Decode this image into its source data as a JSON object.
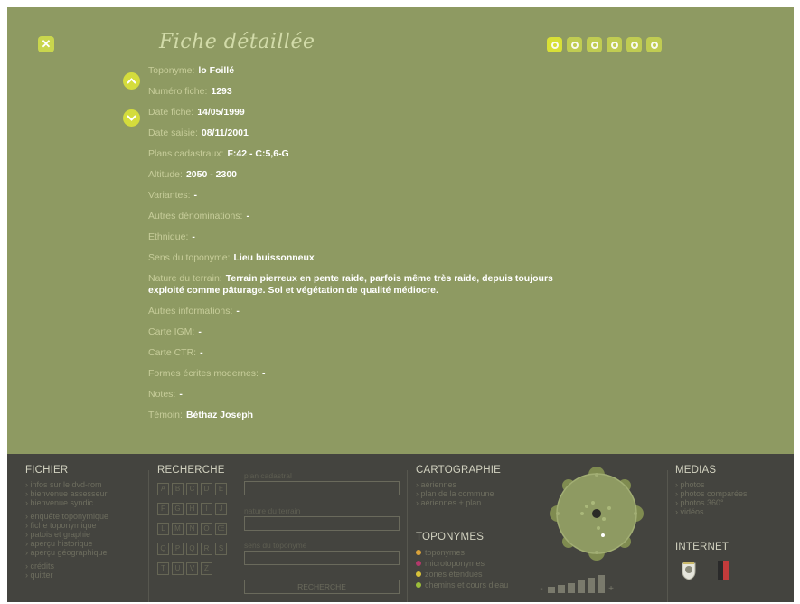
{
  "detail": {
    "title": "Fiche détaillée",
    "close_icon": "close-x-icon",
    "toolbar_icons": [
      "sheet-icon",
      "comment-icon",
      "map-icon",
      "photo-icon",
      "media-icon",
      "print-icon"
    ],
    "nav": {
      "prev_icon": "chevron-up-icon",
      "next_icon": "chevron-down-icon"
    },
    "fields": [
      {
        "label": "Toponyme:",
        "value": "lo Foillé"
      },
      {
        "label": "Numéro fiche:",
        "value": "1293"
      },
      {
        "label": "Date fiche:",
        "value": "14/05/1999"
      },
      {
        "label": "Date saisie:",
        "value": "08/11/2001"
      },
      {
        "label": "Plans cadastraux:",
        "value": "F:42 - C:5,6-G"
      },
      {
        "label": "Altitude:",
        "value": "2050 - 2300"
      },
      {
        "label": "Variantes:",
        "value": "-"
      },
      {
        "label": "Autres dénominations:",
        "value": "-"
      },
      {
        "label": "Ethnique:",
        "value": "-"
      },
      {
        "label": "Sens du toponyme:",
        "value": "Lieu buissonneux"
      },
      {
        "label": "Nature du terrain:",
        "value": "Terrain pierreux en pente raide, parfois même très raide, depuis toujours exploité comme pâturage. Sol et végétation de qualité médiocre."
      },
      {
        "label": "Autres informations:",
        "value": "-"
      },
      {
        "label": "Carte IGM:",
        "value": "-"
      },
      {
        "label": "Carte CTR:",
        "value": "-"
      },
      {
        "label": "Formes écrites modernes:",
        "value": "-"
      },
      {
        "label": "Notes:",
        "value": "-"
      },
      {
        "label": "Témoin:",
        "value": "Béthaz Joseph"
      }
    ]
  },
  "fichier": {
    "title": "FICHIER",
    "groups": [
      [
        "› infos sur le dvd-rom",
        "› bienvenue assesseur",
        "› bienvenue syndic"
      ],
      [
        "› enquête toponymique",
        "› fiche toponymique",
        "› patois et graphie",
        "› aperçu historique",
        "› aperçu géographique"
      ],
      [
        "› crédits",
        "› quitter"
      ]
    ]
  },
  "recherche": {
    "title": "RECHERCHE",
    "letter_rows": [
      [
        "A",
        "B",
        "C",
        "D",
        "E"
      ],
      [
        "F",
        "G",
        "H",
        "I",
        "J"
      ],
      [
        "L",
        "M",
        "N",
        "O",
        "Œ"
      ],
      [
        "Q",
        "P",
        "Q",
        "R",
        "S"
      ],
      [
        "T",
        "U",
        "V",
        "Z"
      ]
    ],
    "fields": [
      {
        "placeholder": "plan cadastral"
      },
      {
        "placeholder": "nature du terrain"
      },
      {
        "placeholder": "sens du toponyme"
      }
    ],
    "button": "RECHERCHE"
  },
  "cartographie": {
    "title": "CARTOGRAPHIE",
    "items": [
      "› aériennes",
      "› plan de la commune",
      "› aériennes + plan"
    ]
  },
  "toponymes": {
    "title": "TOPONYMES",
    "items": [
      {
        "label": "toponymes",
        "color": "#d9a23a"
      },
      {
        "label": "microtoponymes",
        "color": "#b3386b"
      },
      {
        "label": "zones étendues",
        "color": "#d7c23a"
      },
      {
        "label": "chemins et cours d'eau",
        "color": "#9bbd3a"
      }
    ]
  },
  "zoom": {
    "minus": "-",
    "plus": "+"
  },
  "medias": {
    "title": "MEDIAS",
    "items": [
      "› photos",
      "› photos comparées",
      "› photos 360°",
      "› vidéos"
    ]
  },
  "internet": {
    "title": "INTERNET",
    "links": [
      "coat-of-arms-icon",
      "aosta-flag-icon"
    ]
  },
  "colors": {
    "panel": "#8e9a62",
    "footer": "#44443f",
    "accent": "#d4dc3c"
  }
}
